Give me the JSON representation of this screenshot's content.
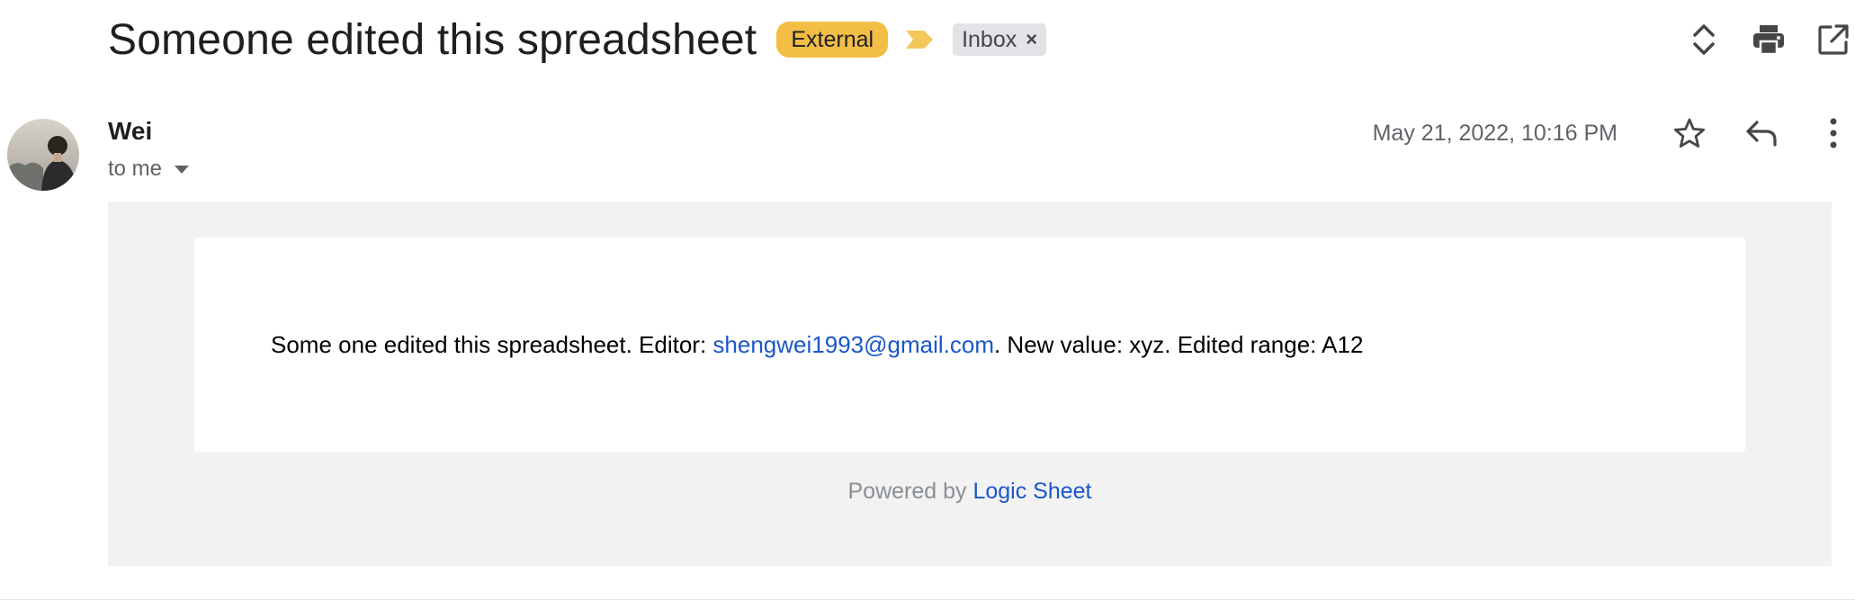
{
  "subject": "Someone edited this spreadsheet",
  "labels": {
    "external": "External",
    "inbox": "Inbox",
    "inbox_remove": "×"
  },
  "top_actions": [
    "expand-collapse-icon",
    "print-icon",
    "open-in-new-window-icon"
  ],
  "sender": {
    "name": "Wei",
    "recipients": "to me",
    "date": "May 21, 2022, 10:16 PM"
  },
  "message_actions": [
    "star-icon",
    "reply-icon",
    "more-vert-icon"
  ],
  "body": {
    "text_before": "Some one edited this spreadsheet. Editor: ",
    "editor_email": "shengwei1993@gmail.com",
    "text_after": ". New value: xyz. Edited range: A12",
    "powered_prefix": "Powered by ",
    "powered_link": "Logic Sheet"
  },
  "colors": {
    "external_badge": "#f3be46",
    "link": "#1a56c9",
    "body_background": "#f2f2f3"
  }
}
